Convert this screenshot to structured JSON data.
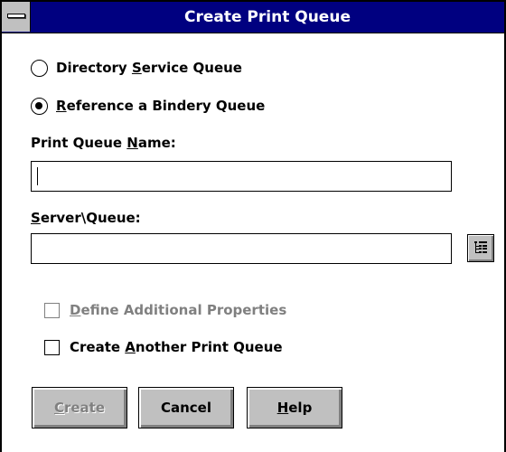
{
  "window": {
    "title": "Create Print Queue"
  },
  "options": {
    "directory_service_queue": {
      "pre": "Directory ",
      "accel": "S",
      "post": "ervice Queue",
      "selected": false
    },
    "reference_bindery_queue": {
      "pre": "",
      "accel": "R",
      "post": "eference a Bindery Queue",
      "selected": true
    }
  },
  "fields": {
    "print_queue_name": {
      "label_pre": "Print Queue ",
      "label_accel": "N",
      "label_post": "ame:",
      "value": ""
    },
    "server_queue": {
      "label_pre": "",
      "label_accel": "S",
      "label_post": "erver\\Queue:",
      "value": ""
    }
  },
  "checkboxes": {
    "define_additional_properties": {
      "pre": "",
      "accel": "D",
      "post": "efine Additional Properties",
      "checked": false,
      "enabled": false
    },
    "create_another_print_queue": {
      "pre": "Create ",
      "accel": "A",
      "post": "nother Print Queue",
      "checked": false,
      "enabled": true
    }
  },
  "buttons": {
    "create": {
      "pre": "",
      "accel": "C",
      "post": "reate",
      "enabled": false
    },
    "cancel": {
      "label": "Cancel",
      "enabled": true
    },
    "help": {
      "pre": "",
      "accel": "H",
      "post": "elp",
      "enabled": true
    }
  },
  "colors": {
    "titlebar": "#000080",
    "face": "#c0c0c0",
    "disabled_text": "#808080"
  },
  "icons": {
    "system_menu": "system-menu-icon",
    "browse": "tree-browse-icon"
  }
}
